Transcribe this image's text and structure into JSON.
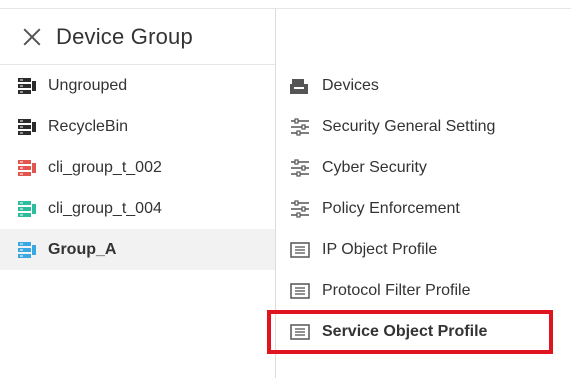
{
  "panel": {
    "title": "Device Group",
    "close_icon": "close-icon"
  },
  "groups": [
    {
      "label": "Ungrouped",
      "icon": "server-group-icon",
      "color": "#2b2b2b",
      "selected": false
    },
    {
      "label": "RecycleBin",
      "icon": "server-group-icon",
      "color": "#2b2b2b",
      "selected": false
    },
    {
      "label": "cli_group_t_002",
      "icon": "server-group-icon",
      "color": "#e2564f",
      "selected": false
    },
    {
      "label": "cli_group_t_004",
      "icon": "server-group-icon",
      "color": "#2dbd9a",
      "selected": false
    },
    {
      "label": "Group_A",
      "icon": "server-group-icon",
      "color": "#3aa7e0",
      "selected": true
    }
  ],
  "menu": [
    {
      "label": "Devices",
      "icon": "device-icon",
      "active": false
    },
    {
      "label": "Security General Setting",
      "icon": "sliders-icon",
      "active": false
    },
    {
      "label": "Cyber Security",
      "icon": "sliders-icon",
      "active": false
    },
    {
      "label": "Policy Enforcement",
      "icon": "sliders-icon",
      "active": false
    },
    {
      "label": "IP Object Profile",
      "icon": "profile-icon",
      "active": false
    },
    {
      "label": "Protocol Filter Profile",
      "icon": "profile-icon",
      "active": false
    },
    {
      "label": "Service Object Profile",
      "icon": "profile-icon",
      "active": true
    }
  ],
  "colors": {
    "highlight": "#e0141e",
    "selected_background": "#f2f2f2"
  }
}
